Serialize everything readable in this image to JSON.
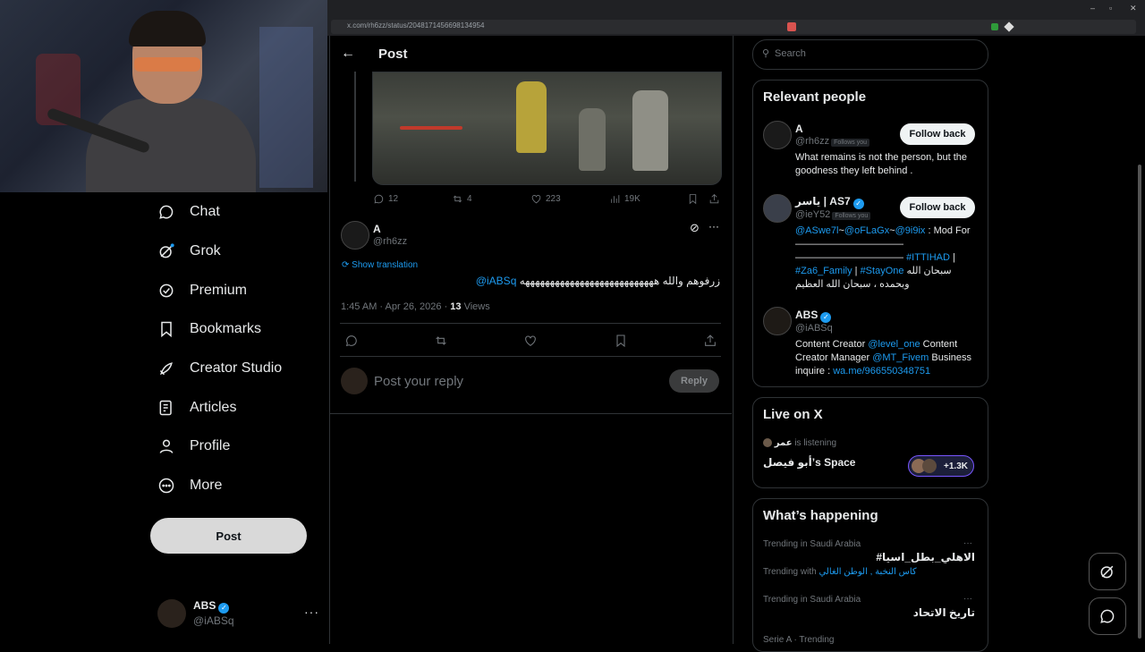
{
  "browser": {
    "url": "x.com/rh6zz/status/2048171456698134954",
    "window_controls": [
      "–",
      "▫",
      "✕"
    ]
  },
  "sidebar": {
    "items": [
      {
        "label": "Chat",
        "icon": "chat-bubble-icon"
      },
      {
        "label": "Grok",
        "icon": "grok-icon"
      },
      {
        "label": "Premium",
        "icon": "premium-icon"
      },
      {
        "label": "Bookmarks",
        "icon": "bookmark-icon"
      },
      {
        "label": "Creator Studio",
        "icon": "rocket-icon"
      },
      {
        "label": "Articles",
        "icon": "article-icon"
      },
      {
        "label": "Profile",
        "icon": "person-icon"
      },
      {
        "label": "More",
        "icon": "more-circle-icon"
      }
    ],
    "post_label": "Post",
    "account": {
      "name": "ABS",
      "handle": "@iABSq",
      "more": "···"
    }
  },
  "header": {
    "back": "←",
    "title": "Post"
  },
  "parent_tweet": {
    "metrics": {
      "replies": "12",
      "reposts": "4",
      "likes": "223",
      "views": "19K"
    }
  },
  "tweet": {
    "name": "A",
    "handle": "@rh6zz",
    "show_translation": "Show translation",
    "mention": "@iABSq",
    "text": "زرفوهم والله هههههههههههههههههههههههههههه",
    "time": "1:45 AM · Apr 26, 2026 · ",
    "views_count": "13",
    "views_label": " Views"
  },
  "reply": {
    "placeholder": "Post your reply",
    "button": "Reply"
  },
  "search": {
    "placeholder": "Search"
  },
  "relevant_people": {
    "title": "Relevant people",
    "follows_you": "Follows you",
    "follow_back": "Follow back",
    "people": [
      {
        "name": "A",
        "handle": "@rh6zz",
        "bio": "What remains is not the person, but the goodness they left behind ."
      },
      {
        "name": "ياسر | AS7",
        "handle": "@ieY52",
        "bio_links": [
          "@ASwe7l",
          "~",
          "@oFLaGx",
          "~",
          "@9i9ix"
        ],
        "bio_tail": " : Mod For",
        "bio_line2": "——————————— ",
        "hashtag1": "#ITTIHAD",
        "pipe": " |",
        "hashtag2": "#Za6_Family",
        "sep": " | ",
        "hashtag3": "#StayOne",
        "arabic1": " سبحان الله",
        "arabic2": "وبحمده ، سبحان الله العظيم"
      },
      {
        "name": "ABS",
        "handle": "@iABSq",
        "bio_a": "Content Creator ",
        "bio_link1": "@level_one",
        "bio_b": " Content Creator Manager ",
        "bio_link2": "@MT_Fivem",
        "bio_c": " Business inquire : ",
        "bio_link3": "wa.me/966550348751"
      }
    ]
  },
  "live": {
    "title": "Live on X",
    "listener": "عمر",
    "status": "is listening",
    "space": "أبو فيصل’s Space",
    "count": "+1.3K"
  },
  "happening": {
    "title": "What’s happening",
    "items": [
      {
        "context": "Trending in Saudi Arabia",
        "topic": "#الاهلي_بطل_اسيا",
        "with_label": "Trending with ",
        "with": "كاس النخبة , الوطن الغالي"
      },
      {
        "context": "Trending in Saudi Arabia",
        "topic": "تاريخ الاتحاد"
      },
      {
        "context": "Serie A · Trending"
      }
    ],
    "more": "···"
  },
  "colors": {
    "accent": "#1d9bf0",
    "border": "#2f3336",
    "muted": "#71767b",
    "background": "#000000"
  }
}
